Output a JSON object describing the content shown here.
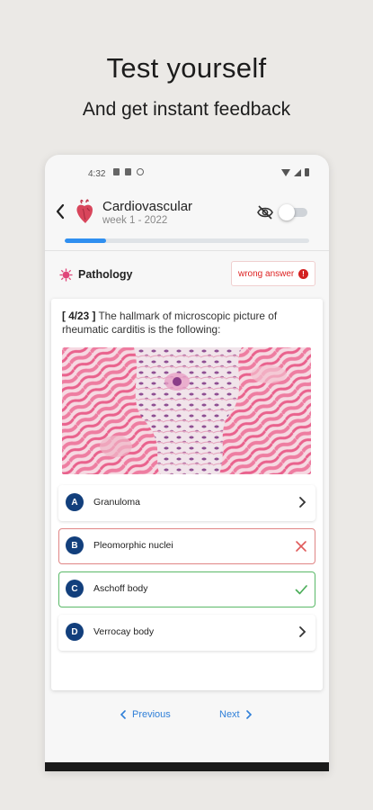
{
  "promo": {
    "title": "Test yourself",
    "subtitle": "And get instant feedback"
  },
  "status_bar": {
    "time": "4:32"
  },
  "header": {
    "title": "Cardiovascular",
    "subtitle": "week 1 - 2022",
    "progress_fraction": 0.17,
    "toggle_on": false
  },
  "category": {
    "label": "Pathology",
    "wrong_answer_label": "wrong answer",
    "wrong_answer_badge": "!"
  },
  "question": {
    "number": "[ 4/23 ]",
    "text": "The hallmark of microscopic picture of rheumatic carditis is the following:"
  },
  "options": [
    {
      "letter": "A",
      "text": "Granuloma",
      "state": "neutral",
      "icon": "chevron-right-icon"
    },
    {
      "letter": "B",
      "text": "Pleomorphic nuclei",
      "state": "wrong",
      "icon": "close-icon"
    },
    {
      "letter": "C",
      "text": "Aschoff body",
      "state": "correct",
      "icon": "check-icon"
    },
    {
      "letter": "D",
      "text": "Verrocay body",
      "state": "neutral",
      "icon": "chevron-right-icon"
    }
  ],
  "navigation": {
    "previous_label": "Previous",
    "next_label": "Next"
  },
  "colors": {
    "accent": "#2f8ff0",
    "letter_badge": "#123f7c",
    "wrong": "#d32020",
    "correct": "#5ab968",
    "link": "#2f7fd8"
  }
}
